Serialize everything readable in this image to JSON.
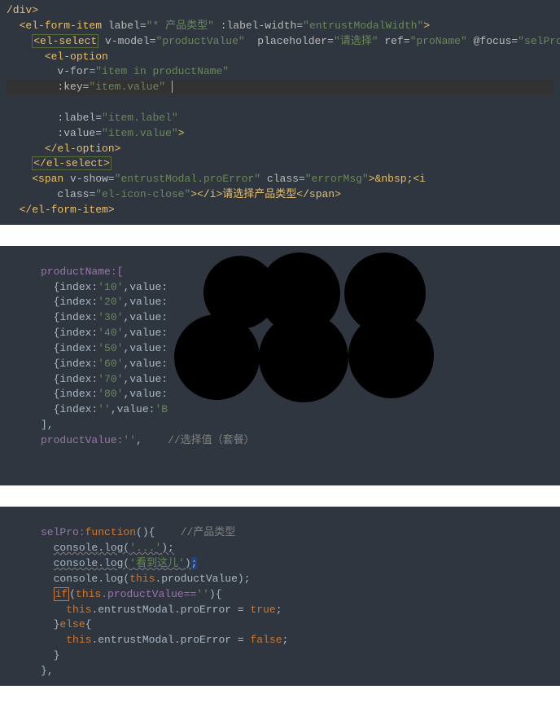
{
  "block1": {
    "l1": "/div>",
    "l2_open": "<el-form-item",
    "l2_attr1": "label",
    "l2_val1": "\"* 产品类型\"",
    "l2_attr2": ":label-width",
    "l2_val2": "\"entrustModalWidth\"",
    "l3_open": "<el-select",
    "l3_attr1": "v-model",
    "l3_val1": "\"productValue\"",
    "l3_attr2": "placeholder",
    "l3_val2": "\"请选择\"",
    "l3_attr3": "ref",
    "l3_val3": "\"proName\"",
    "l3_attr4": "@focus",
    "l3_val4": "\"selPro\"",
    "l4_open": "<el-option",
    "l5_attr": "v-for",
    "l5_val": "\"item in productName\"",
    "l6_attr": ":key",
    "l6_val": "\"item.value\"",
    "l7_attr": ":label",
    "l7_val": "\"item.label\"",
    "l8_attr": ":value",
    "l8_val": "\"item.value\"",
    "l9": "</el-option>",
    "l10": "</el-select>",
    "l11_open": "<span",
    "l11_attr1": "v-show",
    "l11_val1": "\"entrustModal.proError\"",
    "l11_attr2": "class",
    "l11_val2": "\"errorMsg\"",
    "l11_txt": ">&nbsp;<i",
    "l12_attr": "class",
    "l12_val": "\"el-icon-close\"",
    "l12_txt": "></i>请选择产品类型</span>",
    "l13": "</el-form-item>"
  },
  "block2": {
    "l1": "productName:[",
    "l2_a": "{index:",
    "l2_b": "'10'",
    "l2_c": ",value:",
    "l3_b": "'20'",
    "l4_b": "'30'",
    "l5_b": "'40'",
    "l6_b": "'50'",
    "l7_b": "'60'",
    "l8_b": "'70'",
    "l9_b": "'80'",
    "l10_b": "''",
    "l10_d": "'B",
    "l11": "],",
    "l12_a": "productValue:",
    "l12_b": "''",
    "l12_c": ",",
    "l12_comment": "//选择值（套餐）"
  },
  "block3": {
    "l1": "selPro:",
    "l1_fn": "function",
    "l1_b": "(){",
    "l1_comment": "//产品类型",
    "l2_a": "console",
    "l2_b": ".log(",
    "l2_c": "'...'",
    "l2_d": ");",
    "l3_c": "'看到这儿'",
    "l3_d": ")",
    "l4_a": "console",
    "l4_b": ".log(",
    "l4_c": "this",
    "l4_d": ".productValue);",
    "l5_a": "if",
    "l5_b": "(",
    "l5_c": "this",
    "l5_d": ".productValue==",
    "l5_e": "''",
    "l5_f": "){",
    "l6_a": "this",
    "l6_b": ".entrustModal.proError = ",
    "l6_c": "true",
    "l6_d": ";",
    "l7": "}",
    "l7_b": "else",
    "l7_c": "{",
    "l8_a": "this",
    "l8_b": ".entrustModal.proError = ",
    "l8_c": "false",
    "l8_d": ";",
    "l9": "}",
    "l10": "},"
  }
}
